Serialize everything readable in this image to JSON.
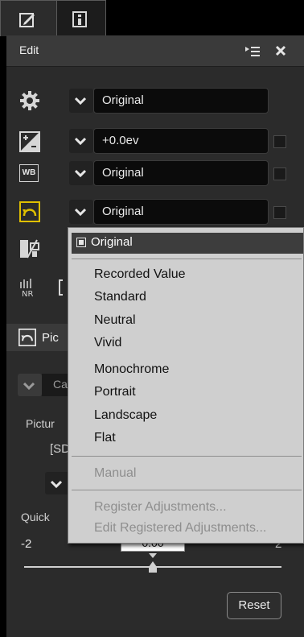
{
  "tabs": [
    {
      "icon": "edit-icon"
    },
    {
      "icon": "info-icon"
    }
  ],
  "edit_panel": {
    "title": "Edit",
    "rows": [
      {
        "icon": "gear-icon",
        "value": "Original"
      },
      {
        "icon": "exposure-compensation-icon",
        "value": "+0.0ev"
      },
      {
        "icon": "white-balance-icon",
        "value": "Original"
      },
      {
        "icon": "picture-control-icon",
        "value": "Original"
      }
    ]
  },
  "picture_control_panel": {
    "title_partial": "Pic",
    "combo_partial": "Ca",
    "label_partial": "Pictur",
    "bracket_partial": "[SD",
    "quick_label_partial": "Quick",
    "slider": {
      "min": "-2",
      "max": "2",
      "value": "0.00"
    },
    "reset_label": "Reset"
  },
  "dropdown_menu": {
    "selected": "Original",
    "items": [
      "Recorded Value",
      "Standard",
      "Neutral",
      "Vivid",
      "Monochrome",
      "Portrait",
      "Landscape",
      "Flat"
    ],
    "manual": "Manual",
    "registered": [
      "Register Adjustments...",
      "Edit Registered Adjustments..."
    ]
  },
  "colors": {
    "accent": "#e0c000",
    "panel": "#2b2b2b",
    "menu_bg": "#cfcfcf"
  }
}
